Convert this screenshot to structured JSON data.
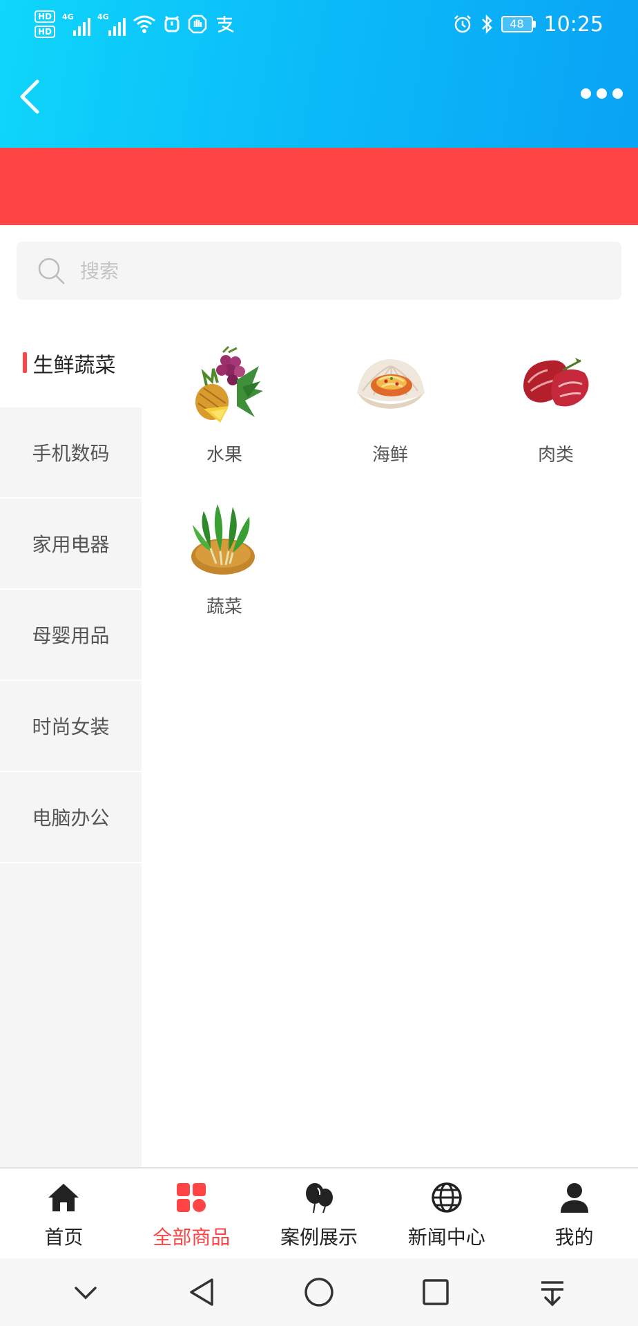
{
  "status_bar": {
    "hd1": "HD",
    "hd2": "HD",
    "net1": "4G",
    "net2": "4G",
    "battery": "48",
    "time": "10:25"
  },
  "header": {
    "back_icon": "chevron-left-icon",
    "more_icon": "more-dots-icon"
  },
  "colors": {
    "header_gradient_start": "#0fd6fb",
    "header_gradient_end": "#0aa3f5",
    "banner": "#fe4444",
    "accent": "#fe4444"
  },
  "search": {
    "placeholder": "搜索",
    "value": ""
  },
  "sidebar": {
    "items": [
      {
        "label": "生鲜蔬菜",
        "active": true
      },
      {
        "label": "手机数码"
      },
      {
        "label": "家用电器"
      },
      {
        "label": "母婴用品"
      },
      {
        "label": "时尚女装"
      },
      {
        "label": "电脑办公"
      }
    ]
  },
  "products": [
    {
      "label": "水果",
      "icon": "fruit-image"
    },
    {
      "label": "海鲜",
      "icon": "seafood-image"
    },
    {
      "label": "肉类",
      "icon": "meat-image"
    },
    {
      "label": "蔬菜",
      "icon": "vegetable-image"
    }
  ],
  "tabbar": {
    "tabs": [
      {
        "label": "首页",
        "icon": "home-icon"
      },
      {
        "label": "全部商品",
        "icon": "grid-icon",
        "active": true
      },
      {
        "label": "案例展示",
        "icon": "balloon-icon"
      },
      {
        "label": "新闻中心",
        "icon": "globe-icon"
      },
      {
        "label": "我的",
        "icon": "user-icon"
      }
    ]
  }
}
